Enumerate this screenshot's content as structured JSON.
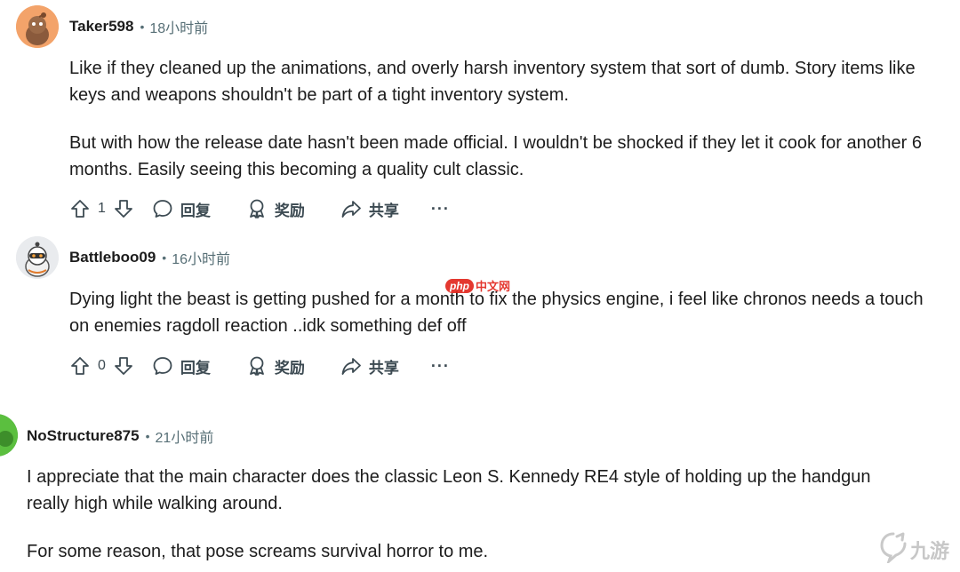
{
  "comments": [
    {
      "username": "Taker598",
      "separator": "•",
      "time": "18小时前",
      "paragraphs": [
        "Like if they cleaned up the animations, and overly harsh inventory system that sort of dumb. Story items like keys and weapons shouldn't be part of a tight inventory system.",
        "But with how the release date hasn't been made official. I wouldn't be shocked if they let it cook for another 6 months. Easily seeing this becoming a quality cult classic."
      ],
      "votes": "1",
      "reply_label": "回复",
      "award_label": "奖励",
      "share_label": "共享",
      "more_label": "···",
      "avatar_color": "#f5a76a"
    },
    {
      "username": "Battleboo09",
      "separator": "•",
      "time": "16小时前",
      "paragraphs": [
        "Dying light the beast is getting pushed for a month to fix the physics engine, i feel like chronos needs a touch on enemies ragdoll reaction ..idk something def off"
      ],
      "votes": "0",
      "reply_label": "回复",
      "award_label": "奖励",
      "share_label": "共享",
      "more_label": "···",
      "avatar_color": "#e8eaec"
    },
    {
      "username": "NoStructure875",
      "separator": "•",
      "time": "21小时前",
      "paragraphs": [
        "I appreciate that the main character does the classic Leon S. Kennedy RE4 style of holding up the handgun really high while walking around.",
        "For some reason, that pose screams survival horror to me."
      ],
      "avatar_color": "#46a535"
    }
  ],
  "watermark": {
    "badge": "php",
    "text": "中文网"
  },
  "corner_logo": {
    "text": "九游"
  }
}
